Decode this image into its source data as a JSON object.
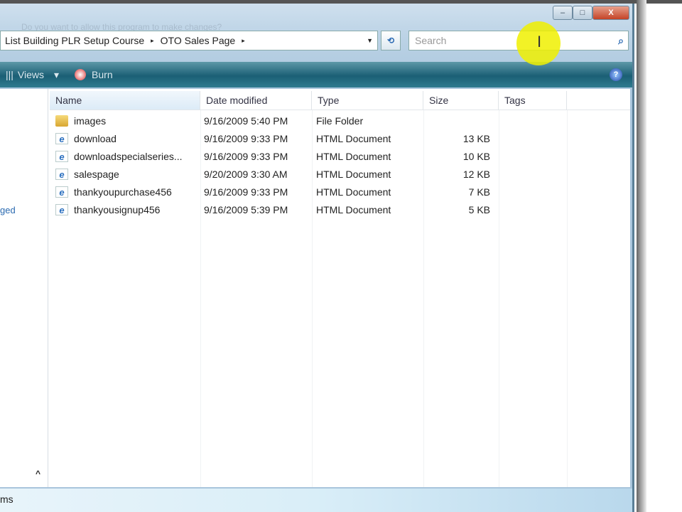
{
  "window": {
    "controls": {
      "minimize": "–",
      "maximize": "□",
      "close": "X"
    },
    "ghost_title": "Do you want to allow this program to make changes?"
  },
  "address": {
    "crumbs": [
      "List Building PLR Setup Course",
      "OTO Sales Page"
    ],
    "separator": "▸",
    "dropdown": "▼",
    "refresh": "⟲"
  },
  "search": {
    "placeholder": "Search",
    "icon": "search-icon"
  },
  "toolbar": {
    "views": "Views",
    "views_dd": "▾",
    "burn": "Burn",
    "help": "?"
  },
  "nav": {
    "link": "ged",
    "collapse": "^"
  },
  "columns": [
    "Name",
    "Date modified",
    "Type",
    "Size",
    "Tags"
  ],
  "files": [
    {
      "name": "images",
      "date": "9/16/2009 5:40 PM",
      "type": "File Folder",
      "size": "",
      "icon": "folder"
    },
    {
      "name": "download",
      "date": "9/16/2009 9:33 PM",
      "type": "HTML Document",
      "size": "13 KB",
      "icon": "ie"
    },
    {
      "name": "downloadspecialseries...",
      "date": "9/16/2009 9:33 PM",
      "type": "HTML Document",
      "size": "10 KB",
      "icon": "ie"
    },
    {
      "name": "salespage",
      "date": "9/20/2009 3:30 AM",
      "type": "HTML Document",
      "size": "12 KB",
      "icon": "ie"
    },
    {
      "name": "thankyoupurchase456",
      "date": "9/16/2009 9:33 PM",
      "type": "HTML Document",
      "size": "7 KB",
      "icon": "ie"
    },
    {
      "name": "thankyousignup456",
      "date": "9/16/2009 5:39 PM",
      "type": "HTML Document",
      "size": "5 KB",
      "icon": "ie"
    }
  ],
  "status": {
    "text": "ms"
  }
}
